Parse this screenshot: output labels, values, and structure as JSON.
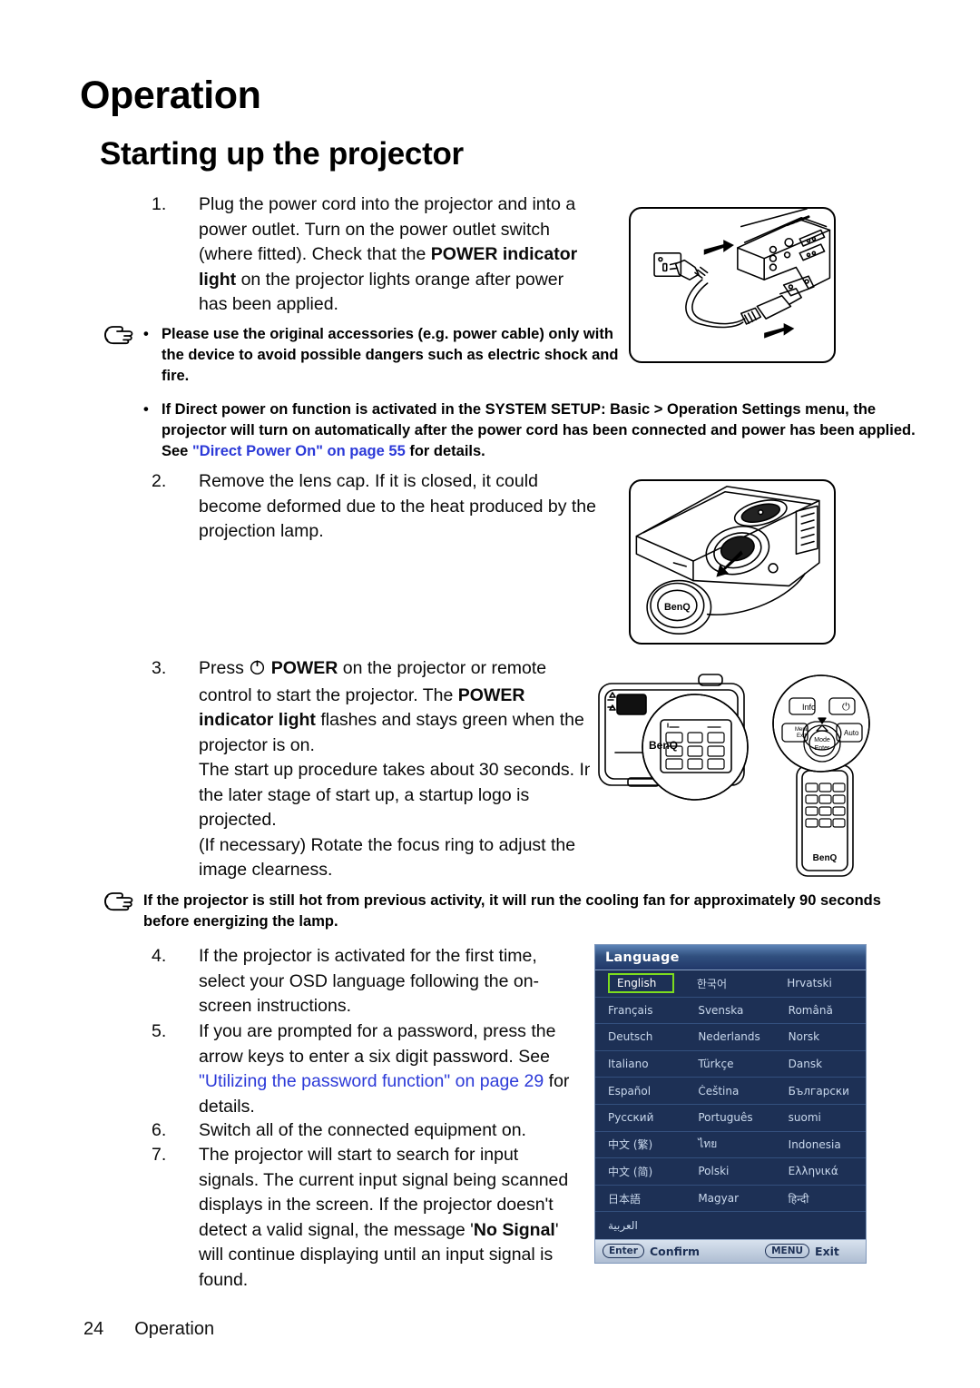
{
  "document": {
    "chapter_title": "Operation",
    "section_title": "Starting up the projector"
  },
  "steps": [
    {
      "num": "1.",
      "parts": [
        {
          "t": "Plug the power cord into the projector and into a power outlet. Turn on the power outlet switch (where fitted). Check that the ",
          "style": "normal"
        },
        {
          "t": "POWER indicator light",
          "style": "bold"
        },
        {
          "t": " on the projector lights orange after power has been applied.",
          "style": "normal"
        }
      ]
    },
    {
      "num": "2.",
      "parts": [
        {
          "t": "Remove the lens cap. If it is closed, it could become deformed due to the heat produced by the projection lamp.",
          "style": "normal"
        }
      ]
    },
    {
      "num": "3.",
      "parts": [
        {
          "t": "Press ",
          "style": "normal"
        },
        {
          "t": "POWER-ICON",
          "style": "icon"
        },
        {
          "t": " ",
          "style": "normal"
        },
        {
          "t": "POWER",
          "style": "bold"
        },
        {
          "t": " on the projector or remote control to start the projector. The ",
          "style": "normal"
        },
        {
          "t": "POWER indicator light",
          "style": "bold"
        },
        {
          "t": " flashes and stays green when the projector is on.",
          "style": "normal"
        },
        {
          "t": "BREAK",
          "style": "break"
        },
        {
          "t": "The start up procedure takes about 30 seconds. In the later stage of start up, a startup logo is projected.",
          "style": "normal"
        },
        {
          "t": "BREAK",
          "style": "break"
        },
        {
          "t": "(If necessary) Rotate the focus ring to adjust the image clearness.",
          "style": "normal"
        }
      ]
    },
    {
      "num": "4.",
      "parts": [
        {
          "t": "If the projector is activated for the first time, select your OSD language following the on-screen instructions.",
          "style": "normal"
        }
      ]
    },
    {
      "num": "5.",
      "parts": [
        {
          "t": "If you are prompted for a password, press the arrow keys to enter a six digit password. See ",
          "style": "normal"
        },
        {
          "t": "\"Utilizing the password function\" on page 29",
          "style": "link"
        },
        {
          "t": " for details.",
          "style": "normal"
        }
      ]
    },
    {
      "num": "6.",
      "parts": [
        {
          "t": "Switch all of the connected equipment on.",
          "style": "normal"
        }
      ]
    },
    {
      "num": "7.",
      "parts": [
        {
          "t": "The projector will start to search for input signals. The current input signal being scanned displays in the screen. If the projector doesn't detect a valid signal, the message '",
          "style": "normal"
        },
        {
          "t": "No Signal",
          "style": "bold"
        },
        {
          "t": "' will continue displaying until an input signal is found.",
          "style": "normal"
        }
      ]
    }
  ],
  "notes": [
    {
      "has_hand": true,
      "has_bullet": true,
      "parts": [
        {
          "t": "Please use the original accessories (e.g. power cable) only with the device to avoid possible dangers such as electric shock and fire.",
          "style": "normal"
        }
      ]
    },
    {
      "has_hand": false,
      "has_bullet": true,
      "parts": [
        {
          "t": "If Direct power on function is activated in the SYSTEM SETUP: Basic  > Operation Settings menu, the projector will turn on automatically after the power cord has been connected and power has been applied. See ",
          "style": "normal"
        },
        {
          "t": "\"Direct Power On\" on page 55",
          "style": "link"
        },
        {
          "t": " for details.",
          "style": "normal"
        }
      ]
    },
    {
      "has_hand": true,
      "has_bullet": false,
      "parts": [
        {
          "t": "If the projector is still hot from previous activity, it will run the cooling fan for approximately 90 seconds before energizing the lamp.",
          "style": "normal"
        }
      ]
    }
  ],
  "osd": {
    "title": "Language",
    "selected": "English",
    "rows": [
      [
        "English",
        "한국어",
        "Hrvatski"
      ],
      [
        "Français",
        "Svenska",
        "Română"
      ],
      [
        "Deutsch",
        "Nederlands",
        "Norsk"
      ],
      [
        "Italiano",
        "Türkçe",
        "Dansk"
      ],
      [
        "Español",
        "Čeština",
        "Български"
      ],
      [
        "Русский",
        "Português",
        "suomi"
      ],
      [
        "中文 (繁)",
        "ไทย",
        "Indonesia"
      ],
      [
        "中文 (简)",
        "Polski",
        "Ελληνικά"
      ],
      [
        "日本語",
        "Magyar",
        "हिन्दी"
      ],
      [
        "العربية",
        "",
        ""
      ]
    ],
    "footer": {
      "confirm_key": "Enter",
      "confirm_label": "Confirm",
      "exit_key": "MENU",
      "exit_label": "Exit"
    },
    "colors": {
      "background": "#1d3055",
      "header_blue": "#31507f",
      "selection_green": "#7ddc1e",
      "text": "#c9d8ec"
    }
  },
  "figures": [
    {
      "name": "power-cord-connection-figure",
      "caption": ""
    },
    {
      "name": "lens-cap-removal-figure",
      "caption": ""
    },
    {
      "name": "projector-remote-control-figure",
      "caption": ""
    }
  ],
  "footer": {
    "page_number": "24",
    "chapter": "Operation"
  }
}
